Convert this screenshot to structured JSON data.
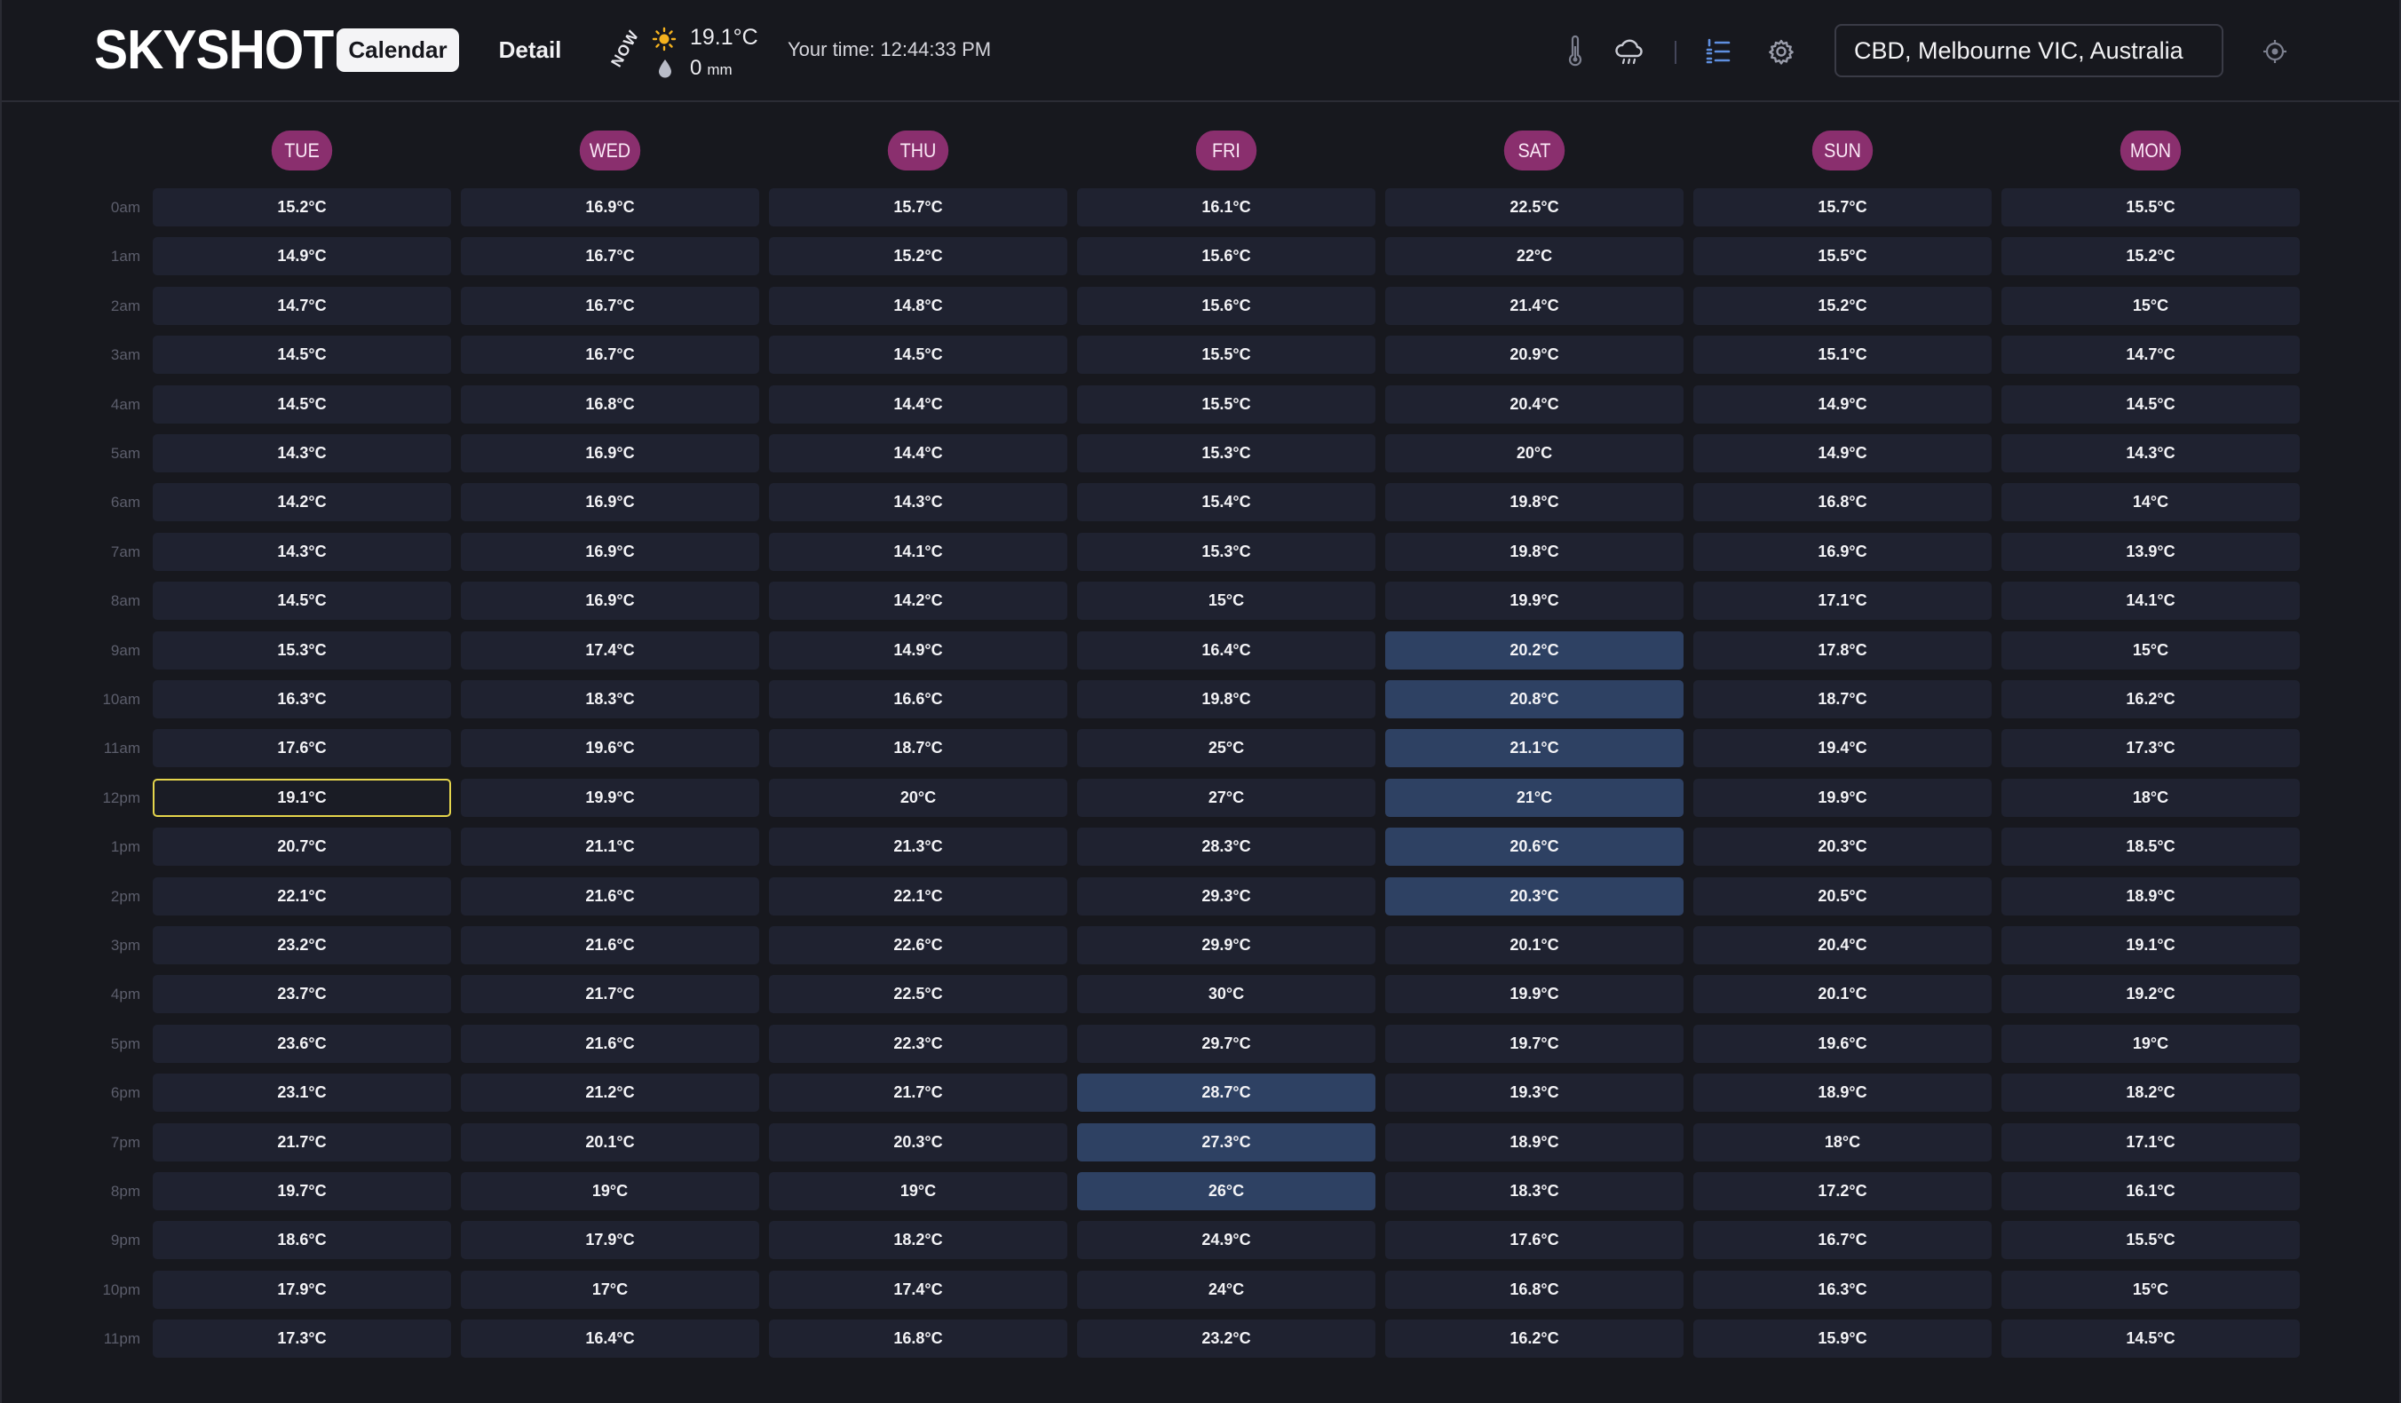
{
  "app": {
    "logo": "SKYSHOT"
  },
  "nav": {
    "calendar_label": "Calendar",
    "detail_label": "Detail"
  },
  "now": {
    "label": "NOW",
    "temperature": "19.1°C",
    "rain_value": "0",
    "rain_unit": "mm"
  },
  "your_time": "Your time: 12:44:33 PM",
  "toolbar": {
    "icons": [
      "thermometer-icon",
      "rain-cloud-icon",
      "list-icon",
      "gear-icon"
    ],
    "locate_icon": "crosshair-icon"
  },
  "search": {
    "value": "CBD, Melbourne VIC, Australia"
  },
  "colors": {
    "day_pill": "#8a2f6e",
    "cell": "#1f2230",
    "highlight": "#2e4163",
    "current": "#e5d54c"
  },
  "days": [
    "TUE",
    "WED",
    "THU",
    "FRI",
    "SAT",
    "SUN",
    "MON"
  ],
  "hours": [
    "0am",
    "1am",
    "2am",
    "3am",
    "4am",
    "5am",
    "6am",
    "7am",
    "8am",
    "9am",
    "10am",
    "11am",
    "12pm",
    "1pm",
    "2pm",
    "3pm",
    "4pm",
    "5pm",
    "6pm",
    "7pm",
    "8pm",
    "9pm",
    "10pm",
    "11pm"
  ],
  "temperatures": [
    [
      "15.2°C",
      "16.9°C",
      "15.7°C",
      "16.1°C",
      "22.5°C",
      "15.7°C",
      "15.5°C"
    ],
    [
      "14.9°C",
      "16.7°C",
      "15.2°C",
      "15.6°C",
      "22°C",
      "15.5°C",
      "15.2°C"
    ],
    [
      "14.7°C",
      "16.7°C",
      "14.8°C",
      "15.6°C",
      "21.4°C",
      "15.2°C",
      "15°C"
    ],
    [
      "14.5°C",
      "16.7°C",
      "14.5°C",
      "15.5°C",
      "20.9°C",
      "15.1°C",
      "14.7°C"
    ],
    [
      "14.5°C",
      "16.8°C",
      "14.4°C",
      "15.5°C",
      "20.4°C",
      "14.9°C",
      "14.5°C"
    ],
    [
      "14.3°C",
      "16.9°C",
      "14.4°C",
      "15.3°C",
      "20°C",
      "14.9°C",
      "14.3°C"
    ],
    [
      "14.2°C",
      "16.9°C",
      "14.3°C",
      "15.4°C",
      "19.8°C",
      "16.8°C",
      "14°C"
    ],
    [
      "14.3°C",
      "16.9°C",
      "14.1°C",
      "15.3°C",
      "19.8°C",
      "16.9°C",
      "13.9°C"
    ],
    [
      "14.5°C",
      "16.9°C",
      "14.2°C",
      "15°C",
      "19.9°C",
      "17.1°C",
      "14.1°C"
    ],
    [
      "15.3°C",
      "17.4°C",
      "14.9°C",
      "16.4°C",
      "20.2°C",
      "17.8°C",
      "15°C"
    ],
    [
      "16.3°C",
      "18.3°C",
      "16.6°C",
      "19.8°C",
      "20.8°C",
      "18.7°C",
      "16.2°C"
    ],
    [
      "17.6°C",
      "19.6°C",
      "18.7°C",
      "25°C",
      "21.1°C",
      "19.4°C",
      "17.3°C"
    ],
    [
      "19.1°C",
      "19.9°C",
      "20°C",
      "27°C",
      "21°C",
      "19.9°C",
      "18°C"
    ],
    [
      "20.7°C",
      "21.1°C",
      "21.3°C",
      "28.3°C",
      "20.6°C",
      "20.3°C",
      "18.5°C"
    ],
    [
      "22.1°C",
      "21.6°C",
      "22.1°C",
      "29.3°C",
      "20.3°C",
      "20.5°C",
      "18.9°C"
    ],
    [
      "23.2°C",
      "21.6°C",
      "22.6°C",
      "29.9°C",
      "20.1°C",
      "20.4°C",
      "19.1°C"
    ],
    [
      "23.7°C",
      "21.7°C",
      "22.5°C",
      "30°C",
      "19.9°C",
      "20.1°C",
      "19.2°C"
    ],
    [
      "23.6°C",
      "21.6°C",
      "22.3°C",
      "29.7°C",
      "19.7°C",
      "19.6°C",
      "19°C"
    ],
    [
      "23.1°C",
      "21.2°C",
      "21.7°C",
      "28.7°C",
      "19.3°C",
      "18.9°C",
      "18.2°C"
    ],
    [
      "21.7°C",
      "20.1°C",
      "20.3°C",
      "27.3°C",
      "18.9°C",
      "18°C",
      "17.1°C"
    ],
    [
      "19.7°C",
      "19°C",
      "19°C",
      "26°C",
      "18.3°C",
      "17.2°C",
      "16.1°C"
    ],
    [
      "18.6°C",
      "17.9°C",
      "18.2°C",
      "24.9°C",
      "17.6°C",
      "16.7°C",
      "15.5°C"
    ],
    [
      "17.9°C",
      "17°C",
      "17.4°C",
      "24°C",
      "16.8°C",
      "16.3°C",
      "15°C"
    ],
    [
      "17.3°C",
      "16.4°C",
      "16.8°C",
      "23.2°C",
      "16.2°C",
      "15.9°C",
      "14.5°C"
    ]
  ],
  "highlighted_cells": [
    [
      9,
      4
    ],
    [
      10,
      4
    ],
    [
      11,
      4
    ],
    [
      12,
      4
    ],
    [
      13,
      4
    ],
    [
      14,
      4
    ],
    [
      18,
      3
    ],
    [
      19,
      3
    ],
    [
      20,
      3
    ]
  ],
  "current_cell": [
    12,
    0
  ]
}
